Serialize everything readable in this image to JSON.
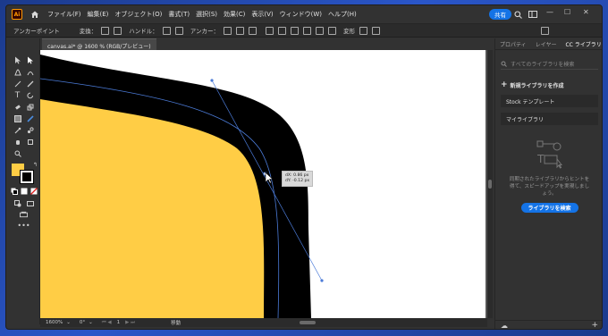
{
  "app": {
    "logo_text": "Ai",
    "menus": [
      "ファイル(F)",
      "編集(E)",
      "オブジェクト(O)",
      "書式(T)",
      "選択(S)",
      "効果(C)",
      "表示(V)",
      "ウィンドウ(W)",
      "ヘルプ(H)"
    ],
    "share_label": "共有",
    "accent": "#1473e6"
  },
  "control_bar": {
    "anchor_label": "アンカーポイント",
    "convert_label": "変換：",
    "handle_label": "ハンドル：",
    "anchor2_label": "アンカー：",
    "transform_label": "変形"
  },
  "document": {
    "tab_label": "canvas.ai* @ 1600 % (RGB/プレビュー)",
    "fill_color": "#ffcd45",
    "stroke_color": "#000000",
    "path_color": "#4b7bd8"
  },
  "tooltip": {
    "dx": "dX: 0.86 px",
    "dy": "dY: -0.12 px"
  },
  "status": {
    "zoom": "1600%",
    "rotation": "0°",
    "artboard_num": "1",
    "mode": "移動"
  },
  "panel": {
    "tabs": [
      "プロパティ",
      "レイヤー",
      "CC ライブラリ"
    ],
    "search_placeholder": "すべてのライブラリを検索",
    "new_library": "新規ライブラリを作成",
    "libraries": [
      "Stock テンプレート",
      "マイライブラリ"
    ],
    "empty_text": "同期されたライブラリからヒントを得て、スピードアップを実現しましょう。",
    "search_button": "ライブラリを検索"
  }
}
